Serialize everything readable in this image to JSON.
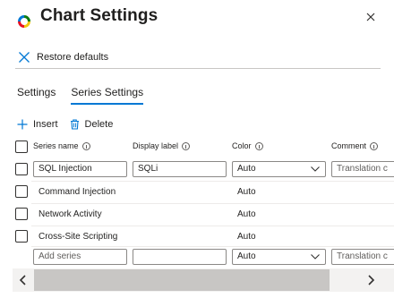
{
  "panel": {
    "title": "Chart Settings",
    "logo_icon": "multicolor-ring-logo",
    "close_icon": "close-icon"
  },
  "toolbar_top": {
    "restore_label": "Restore defaults",
    "restore_icon": "close-x-icon"
  },
  "tabs": [
    {
      "label": "Settings",
      "active": false
    },
    {
      "label": "Series Settings",
      "active": true
    }
  ],
  "series_toolbar": {
    "insert_label": "Insert",
    "delete_label": "Delete"
  },
  "columns": {
    "series_name": "Series name",
    "display_label": "Display label",
    "color": "Color",
    "comment": "Comment"
  },
  "rows": [
    {
      "series_name": "SQL Injection",
      "display_label": "SQLi",
      "color": "Auto",
      "comment_placeholder": "Translation c",
      "editing": true
    },
    {
      "series_name": "Command Injection",
      "display_label": "",
      "color": "Auto",
      "editing": false
    },
    {
      "series_name": "Network Activity",
      "display_label": "",
      "color": "Auto",
      "editing": false
    },
    {
      "series_name": "Cross-Site Scripting",
      "display_label": "",
      "color": "Auto",
      "editing": false
    }
  ],
  "new_row": {
    "series_placeholder": "Add series",
    "display_label_value": "",
    "color": "Auto",
    "comment_placeholder": "Translation c"
  },
  "accent_color": "#0078d4"
}
